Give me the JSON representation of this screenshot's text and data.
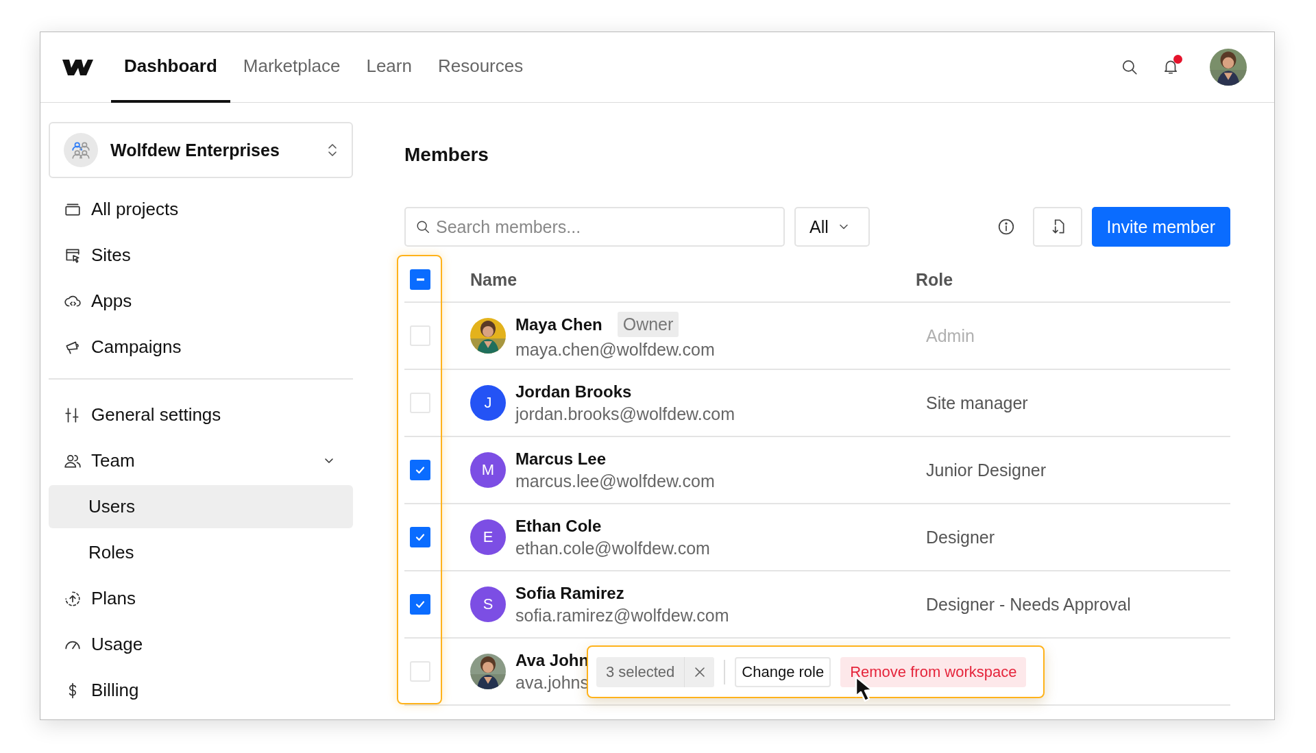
{
  "nav": {
    "tabs": [
      {
        "label": "Dashboard",
        "selected": true
      },
      {
        "label": "Marketplace",
        "selected": false
      },
      {
        "label": "Learn",
        "selected": false
      },
      {
        "label": "Resources",
        "selected": false
      }
    ],
    "notifications": {
      "unread": true
    }
  },
  "sidebar": {
    "workspace": {
      "name": "Wolfdew Enterprises"
    },
    "sections": [
      {
        "items": [
          {
            "label": "All projects",
            "selected": false
          },
          {
            "label": "Sites",
            "selected": false
          },
          {
            "label": "Apps",
            "selected": false
          },
          {
            "label": "Campaigns",
            "selected": false
          }
        ]
      },
      {
        "items": [
          {
            "label": "General settings",
            "selected": false
          },
          {
            "label": "Team",
            "selected": false,
            "expanded": true,
            "children": [
              {
                "label": "Users",
                "selected": true
              },
              {
                "label": "Roles",
                "selected": false
              }
            ]
          },
          {
            "label": "Plans",
            "selected": false
          },
          {
            "label": "Usage",
            "selected": false
          },
          {
            "label": "Billing",
            "selected": false
          }
        ]
      }
    ]
  },
  "members": {
    "title": "Members",
    "search": {
      "placeholder": "Search members..."
    },
    "filter": {
      "value": "All"
    },
    "invite_button": "Invite member",
    "table": {
      "columns": [
        "Name",
        "Role"
      ],
      "select_all": {
        "indeterminate": true
      },
      "rows": [
        {
          "name": "Maya Chen",
          "badge": "Owner",
          "email": "maya.chen@wolfdew.com",
          "role": "Admin",
          "role_disabled": true,
          "checked": false
        },
        {
          "name": "Jordan Brooks",
          "email": "jordan.brooks@wolfdew.com",
          "role": "Site manager",
          "role_disabled": false,
          "checked": false,
          "avatar": {
            "kind": "initial",
            "initial": "J",
            "color": "#2453f5"
          }
        },
        {
          "name": "Marcus Lee",
          "email": "marcus.lee@wolfdew.com",
          "role": "Junior Designer",
          "role_disabled": false,
          "checked": true,
          "avatar": {
            "kind": "initial",
            "initial": "M",
            "color": "#7c4ee4"
          }
        },
        {
          "name": "Ethan Cole",
          "email": "ethan.cole@wolfdew.com",
          "role": "Designer",
          "role_disabled": false,
          "checked": true,
          "avatar": {
            "kind": "initial",
            "initial": "E",
            "color": "#7c4ee4"
          }
        },
        {
          "name": "Sofia Ramirez",
          "email": "sofia.ramirez@wolfdew.com",
          "role": "Designer - Needs Approval",
          "role_disabled": false,
          "checked": true,
          "avatar": {
            "kind": "initial",
            "initial": "S",
            "color": "#7c4ee4"
          }
        },
        {
          "name": "Ava John",
          "email": "ava.johns",
          "checked": false
        }
      ]
    },
    "bulk_bar": {
      "count": "3 selected",
      "actions": [
        {
          "label": "Change role",
          "kind": "outline"
        },
        {
          "label": "Remove from workspace",
          "kind": "danger"
        }
      ]
    }
  }
}
